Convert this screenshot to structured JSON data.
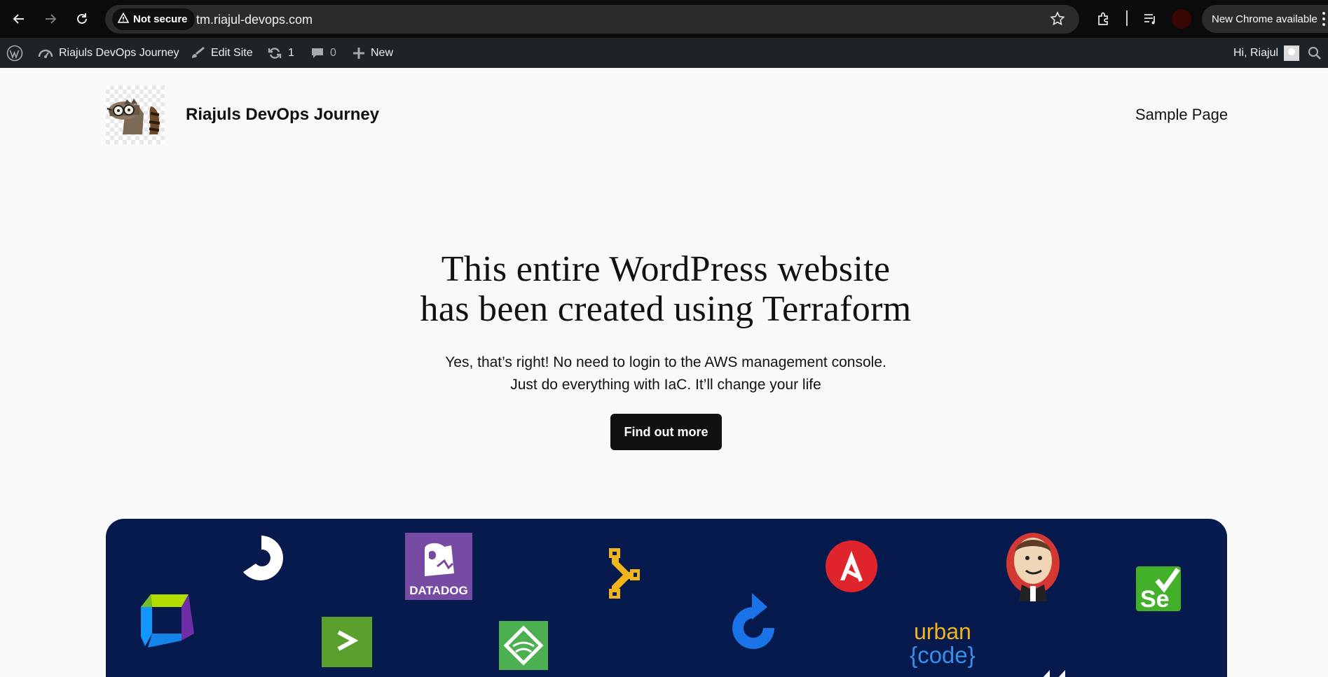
{
  "browser": {
    "security_label": "Not secure",
    "url": "tm.riajul-devops.com",
    "update_label": "New Chrome available"
  },
  "admin_bar": {
    "site_name": "Riajuls DevOps Journey",
    "edit_site": "Edit Site",
    "updates_count": "1",
    "comments_count": "0",
    "new_label": "New",
    "greeting": "Hi, Riajul"
  },
  "site": {
    "title": "Riajuls DevOps Journey",
    "nav": [
      "Sample Page"
    ]
  },
  "hero": {
    "title_line1": "This entire WordPress website",
    "title_line2": "has been created using Terraform",
    "text_line1": "Yes, that’s right! No need to login to the AWS management console.",
    "text_line2": "Just do everything with IaC. It’ll change your life",
    "button_label": "Find out more"
  },
  "banner": {
    "background": "#061a4e",
    "datadog_label": "DATADOG",
    "urbancode_line1": "urban",
    "urbancode_line2": "{code}",
    "selenium_label": "Se",
    "icons": [
      "circleci-icon",
      "datadog-icon",
      "pipeline-icon",
      "ansible-icon",
      "jenkins-icon",
      "selenium-icon",
      "dynatrace-icon",
      "powershell-icon",
      "sumo-icon",
      "refresh-ci-icon",
      "urbancode-icon",
      "fast-forward-icon"
    ]
  }
}
